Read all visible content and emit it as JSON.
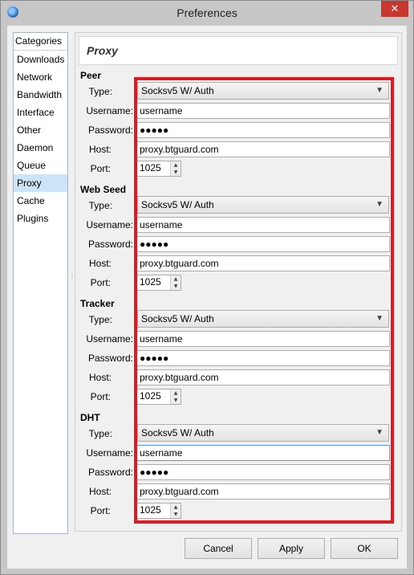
{
  "window": {
    "title": "Preferences",
    "close_label": "✕"
  },
  "sidebar": {
    "header": "Categories",
    "items": [
      {
        "label": "Downloads"
      },
      {
        "label": "Network"
      },
      {
        "label": "Bandwidth"
      },
      {
        "label": "Interface"
      },
      {
        "label": "Other"
      },
      {
        "label": "Daemon"
      },
      {
        "label": "Queue"
      },
      {
        "label": "Proxy",
        "active": true
      },
      {
        "label": "Cache"
      },
      {
        "label": "Plugins"
      }
    ]
  },
  "panel": {
    "title": "Proxy",
    "labels": {
      "type": "Type:",
      "username": "Username:",
      "password": "Password:",
      "host": "Host:",
      "port": "Port:"
    },
    "sections": [
      {
        "title": "Peer",
        "type": "Socksv5 W/ Auth",
        "username": "username",
        "password": "●●●●●",
        "host": "proxy.btguard.com",
        "port": "1025"
      },
      {
        "title": "Web Seed",
        "type": "Socksv5 W/ Auth",
        "username": "username",
        "password": "●●●●●",
        "host": "proxy.btguard.com",
        "port": "1025"
      },
      {
        "title": "Tracker",
        "type": "Socksv5 W/ Auth",
        "username": "username",
        "password": "●●●●●",
        "host": "proxy.btguard.com",
        "port": "1025"
      },
      {
        "title": "DHT",
        "type": "Socksv5 W/ Auth",
        "username": "username",
        "password": "●●●●●",
        "host": "proxy.btguard.com",
        "port": "1025"
      }
    ]
  },
  "buttons": {
    "cancel": "Cancel",
    "apply": "Apply",
    "ok": "OK"
  },
  "colors": {
    "highlight": "#e01923",
    "active_item": "#cce4f7",
    "close_button": "#c7372f"
  }
}
